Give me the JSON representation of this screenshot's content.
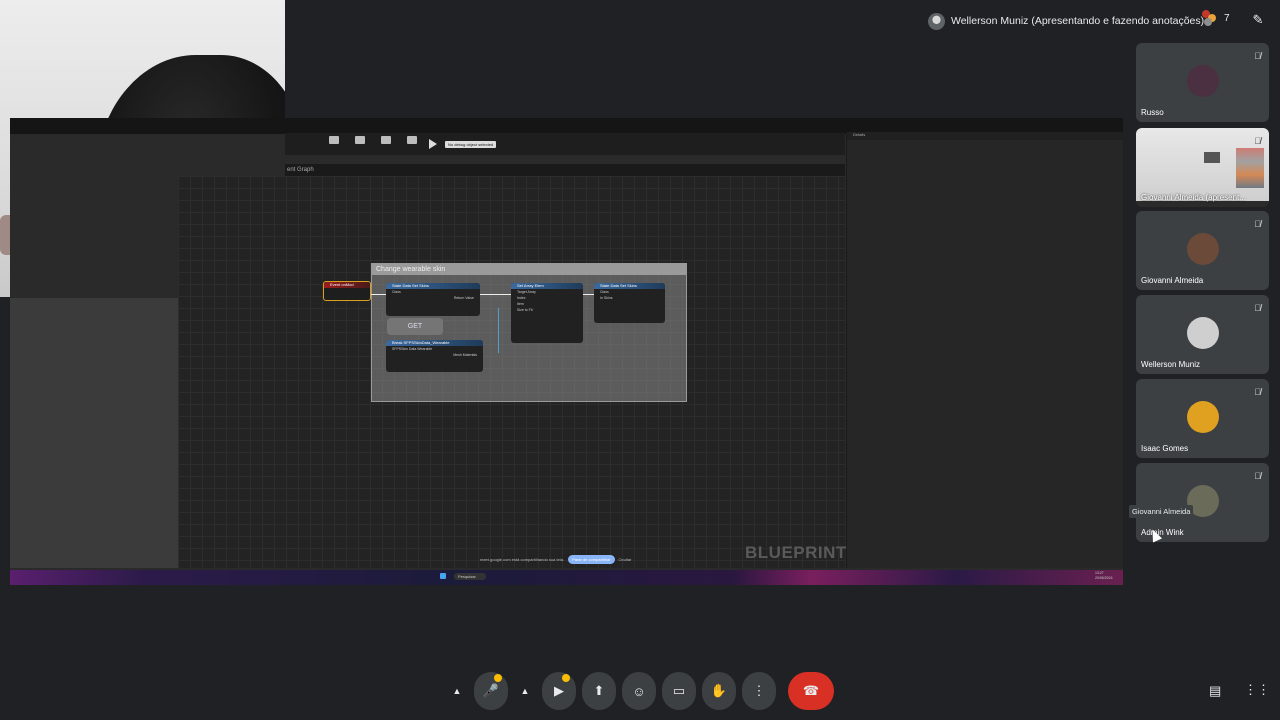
{
  "header": {
    "presenter_text": "Wellerson Muniz (Apresentando e fazendo anotações)",
    "people_count": "7"
  },
  "screen": {
    "toolbar_debug": "No debug object selected",
    "tab_label": "ent Graph",
    "watermark": "BLUEPRINT",
    "comment_title": "Change wearable skin",
    "get_label": "GET",
    "share_text": "meet.google.com está compartilhando sua tela.",
    "stop_share": "Parar de compartilhar",
    "hide_share": "Ocultar",
    "taskbar_search": "Pesquisar",
    "clock_time": "13:27",
    "clock_date": "20/06/2024",
    "details_header": "Details",
    "nodes": {
      "event": "Event onMod",
      "state1": "State Data Set Skins",
      "state1_pin": "Class",
      "state1_ret": "Return Value",
      "break": "Break SFPSSkinData_Wearable",
      "break_pin": "SFPSSkin Data Wearable",
      "break_pin2": "Mesh Materials",
      "array": "Set Array Elem",
      "array_pin1": "Target Array",
      "array_pin2": "Index",
      "array_pin3": "Item",
      "array_pin4": "Size to Fit",
      "state2": "State Data Set Skins",
      "state2_pin": "Class",
      "state2_pin2": "In Skins"
    }
  },
  "participants": [
    {
      "name": "Russo",
      "avatar_color": "#4a3040"
    },
    {
      "name": "Giovanni Almeida (apresent..."
    },
    {
      "name": "Giovanni Almeida",
      "avatar_color": "#6b4a3a"
    },
    {
      "name": "Wellerson Muniz",
      "avatar_color": "#cfcfcf"
    },
    {
      "name": "Isaac Gomes",
      "avatar_color": "#e0a020"
    },
    {
      "name": "Admin Wink",
      "avatar_color": "#6b6b5a"
    }
  ],
  "tooltip": "Giovanni Almeida",
  "controls": {
    "mic": "microphone-icon",
    "camera": "camera-icon",
    "present": "present-screen-icon",
    "emoji": "emoji-icon",
    "captions": "captions-icon",
    "raise_hand": "raise-hand-icon",
    "more": "more-options-icon",
    "end_call": "end-call-icon",
    "chat": "chat-icon",
    "activities": "apps-grid-icon"
  },
  "colors": {
    "end_call": "#d93025",
    "indicator": "#fbbc04",
    "background": "#202124"
  }
}
